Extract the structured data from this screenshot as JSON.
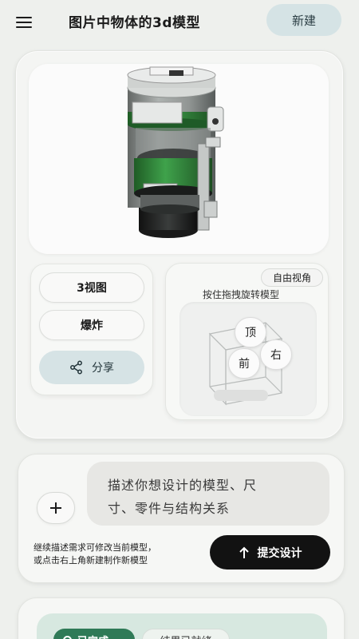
{
  "header": {
    "title": "图片中物体的3d模型",
    "new_button": "新建",
    "menu_icon": "menu-icon"
  },
  "viewer": {
    "model_icon": "3d-cylinder-model"
  },
  "actions": {
    "three_view": "3视图",
    "explode": "爆炸",
    "share": "分享",
    "share_icon": "share-icon"
  },
  "orbit": {
    "free_view": "自由视角",
    "hint": "按住拖拽旋转模型",
    "top": "顶",
    "front": "前",
    "right": "右"
  },
  "composer": {
    "plus_icon": "plus-icon",
    "prompt_line1": "描述你想设计的模型、尺",
    "prompt_line2": "寸、零件与结构关系",
    "helper_line1": "继续描述需求可修改当前模型，",
    "helper_line2": "或点击右上角新建制作新模型",
    "submit": "提交设计",
    "submit_icon": "arrow-up-icon"
  },
  "bottom": {
    "status": "已完成",
    "result": "结果已就绪"
  },
  "colors": {
    "accent_teal": "#d6e3e5",
    "green_band": "#2e8f3a",
    "submit_bg": "#121212",
    "done_green": "#2f7a57"
  }
}
